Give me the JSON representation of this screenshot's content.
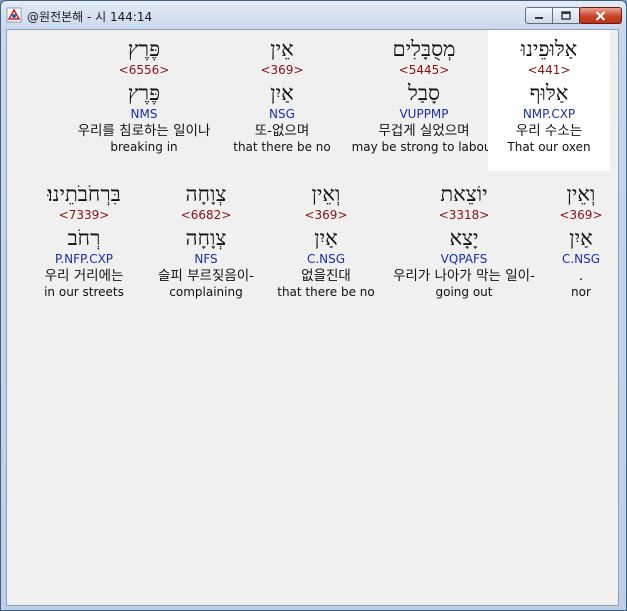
{
  "window": {
    "title": "@원전본해 - 시 144:14"
  },
  "rows": [
    [
      {
        "heb": "פֶּרֶץ",
        "strong": "<6556>",
        "lemma": "פֶּרֶץ",
        "parse": "NMS",
        "kor": "우리를 침로하는 일이나",
        "eng": "breaking in"
      },
      {
        "heb": "אֵין",
        "strong": "<369>",
        "lemma": "אַיִן",
        "parse": "NSG",
        "kor": "또-없으며",
        "eng": "that there be no"
      },
      {
        "heb": "מְסֻבָּלִים",
        "strong": "<5445>",
        "lemma": "סָבַל",
        "parse": "VUPPMP",
        "kor": "무겁게 실었으며",
        "eng": "may be strong to labour"
      },
      {
        "heb": "אַלּוּפֵינוּ",
        "strong": "<441>",
        "lemma": "אַלּוּף",
        "parse": "NMP.CXP",
        "kor": "우리 수소는",
        "eng": "That our oxen",
        "highlight": true
      }
    ],
    [
      {
        "heb": "בִּרְחֹבֹתֵינוּ׃",
        "strong": "<7339>",
        "lemma": "רְחֹב",
        "parse": "P.NFP.CXP",
        "kor": "우리 거리에는",
        "eng": "in our streets"
      },
      {
        "heb": "צְוָחָה",
        "strong": "<6682>",
        "lemma": "צְוָחָה",
        "parse": "NFS",
        "kor": "슬피 부르짖음이-",
        "eng": "complaining"
      },
      {
        "heb": "וְאֵין",
        "strong": "<369>",
        "lemma": "אַיִן",
        "parse": "C.NSG",
        "kor": "없을진대",
        "eng": "that there be no"
      },
      {
        "heb": "יוֹצֵאת",
        "strong": "<3318>",
        "lemma": "יָצָא",
        "parse": "VQPAFS",
        "kor": "우리가 나아가 막는 일이-",
        "eng": "going out"
      },
      {
        "heb": "וְאֵין",
        "strong": "<369>",
        "lemma": "אַיִן",
        "parse": "C.NSG",
        "kor": ".",
        "eng": "nor"
      }
    ]
  ],
  "colors": {
    "strong": "#8b1010",
    "parse": "#1b2fa8",
    "highlight": "#ffffff"
  }
}
